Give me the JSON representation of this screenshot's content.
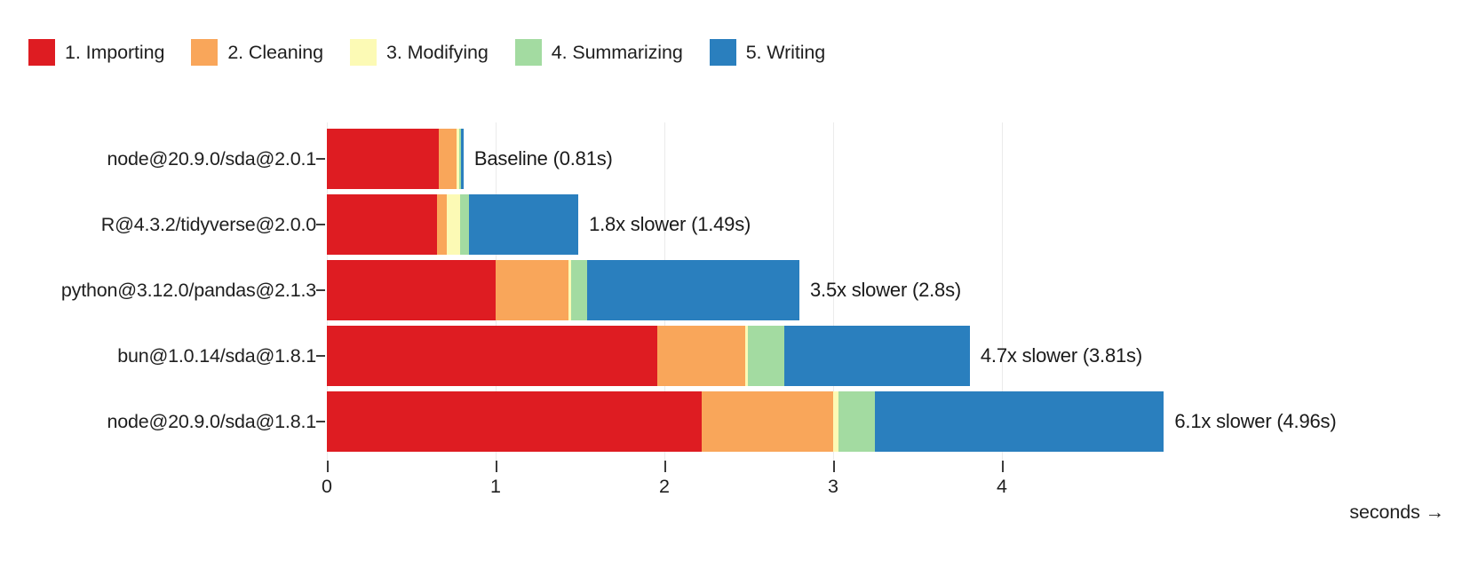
{
  "chart_data": {
    "type": "bar",
    "orientation": "horizontal",
    "stacked": true,
    "title": "",
    "xlabel": "seconds →",
    "ylabel": "",
    "xlim": [
      0,
      5.35
    ],
    "grid": true,
    "legend_position": "top-left",
    "xticks": [
      "0",
      "1",
      "2",
      "3",
      "4"
    ],
    "xtick_values": [
      0,
      1,
      2,
      3,
      4
    ],
    "categories": [
      "node@20.9.0/sda@2.0.1",
      "R@4.3.2/tidyverse@2.0.0",
      "python@3.12.0/pandas@2.1.3",
      "bun@1.0.14/sda@1.8.1",
      "node@20.9.0/sda@1.8.1"
    ],
    "series": [
      {
        "name": "1. Importing",
        "color": "#de1c22",
        "values": [
          0.665,
          0.65,
          1.0,
          1.96,
          2.22
        ]
      },
      {
        "name": "2. Cleaning",
        "color": "#f9a65a",
        "values": [
          0.105,
          0.058,
          0.43,
          0.52,
          0.78
        ]
      },
      {
        "name": "3. Modifying",
        "color": "#fcfab5",
        "values": [
          0.013,
          0.082,
          0.02,
          0.015,
          0.03
        ]
      },
      {
        "name": "4. Summarizing",
        "color": "#a3dba1",
        "values": [
          0.012,
          0.05,
          0.09,
          0.215,
          0.22
        ]
      },
      {
        "name": "5. Writing",
        "color": "#2a7fbe",
        "values": [
          0.015,
          0.65,
          1.26,
          1.1,
          1.71
        ]
      }
    ],
    "totals": [
      0.81,
      1.49,
      2.8,
      3.81,
      4.96
    ],
    "annotations": [
      "Baseline (0.81s)",
      "1.8x slower (1.49s)",
      "3.5x slower (2.8s)",
      "4.7x slower (3.81s)",
      "6.1x slower (4.96s)"
    ]
  },
  "legend": {
    "items": [
      {
        "label": "1. Importing",
        "color": "#de1c22"
      },
      {
        "label": "2. Cleaning",
        "color": "#f9a65a"
      },
      {
        "label": "3. Modifying",
        "color": "#fcfab5"
      },
      {
        "label": "4. Summarizing",
        "color": "#a3dba1"
      },
      {
        "label": "5. Writing",
        "color": "#2a7fbe"
      }
    ]
  },
  "axis": {
    "title": "seconds →",
    "ticks": [
      "0",
      "1",
      "2",
      "3",
      "4"
    ]
  },
  "colors": {
    "importing": "#de1c22",
    "cleaning": "#f9a65a",
    "modifying": "#fcfab5",
    "summarizing": "#a3dba1",
    "writing": "#2a7fbe",
    "gridline": "#ebebeb",
    "text": "#1f1f1f",
    "background": "#ffffff"
  }
}
